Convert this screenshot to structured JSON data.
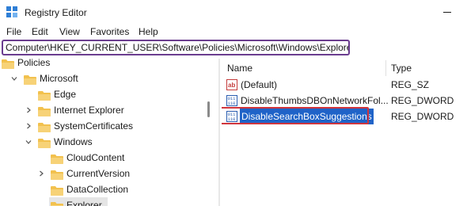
{
  "window": {
    "title": "Registry Editor",
    "icon": "registry-editor-icon"
  },
  "menubar": {
    "items": [
      "File",
      "Edit",
      "View",
      "Favorites",
      "Help"
    ]
  },
  "address": {
    "path": "Computer\\HKEY_CURRENT_USER\\Software\\Policies\\Microsoft\\Windows\\Explorer"
  },
  "tree": {
    "nodes": [
      {
        "label": "Policies",
        "expander": "none",
        "selected": false
      },
      {
        "label": "Microsoft",
        "expander": "expanded",
        "selected": false
      },
      {
        "label": "Edge",
        "expander": "none",
        "selected": false
      },
      {
        "label": "Internet Explorer",
        "expander": "collapsed",
        "selected": false
      },
      {
        "label": "SystemCertificates",
        "expander": "collapsed",
        "selected": false
      },
      {
        "label": "Windows",
        "expander": "expanded",
        "selected": false
      },
      {
        "label": "CloudContent",
        "expander": "none",
        "selected": false
      },
      {
        "label": "CurrentVersion",
        "expander": "collapsed",
        "selected": false
      },
      {
        "label": "DataCollection",
        "expander": "none",
        "selected": false
      },
      {
        "label": "Explorer",
        "expander": "none",
        "selected": true
      }
    ]
  },
  "values": {
    "columns": {
      "name": "Name",
      "type": "Type"
    },
    "rows": [
      {
        "name": "(Default)",
        "type": "REG_SZ",
        "icon": "string-value-icon",
        "highlighted": false
      },
      {
        "name": "DisableThumbsDBOnNetworkFol...",
        "type": "REG_DWORD",
        "icon": "dword-value-icon",
        "highlighted": false
      },
      {
        "name": "DisableSearchBoxSuggestions",
        "type": "REG_DWORD",
        "icon": "dword-value-icon",
        "highlighted": true
      }
    ]
  },
  "colors": {
    "folder": "#f2c14e",
    "selection": "#1f63c8",
    "address_border": "#6b3d8f",
    "callout_border": "#d0353d"
  }
}
